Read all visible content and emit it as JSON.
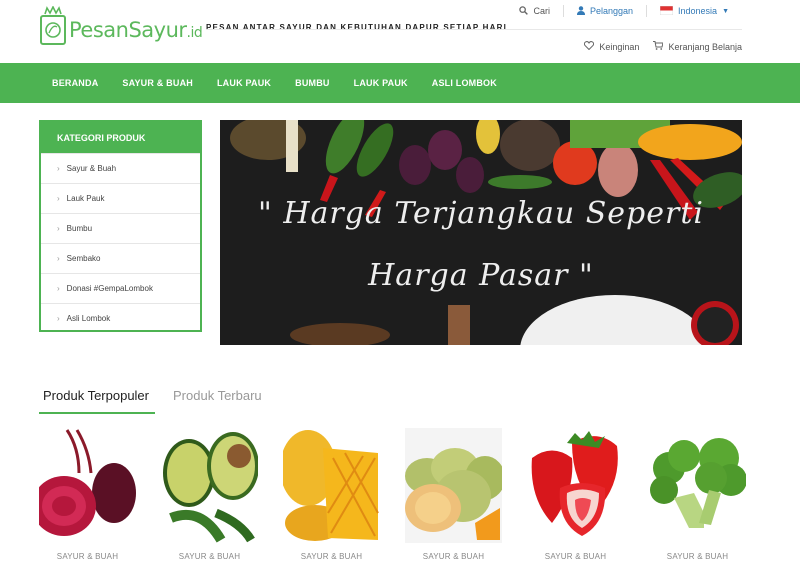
{
  "brand": {
    "logo_main": "PesanSayur",
    "logo_suffix": ".id",
    "tagline": "PESAN ANTAR SAYUR DAN KEBUTUHAN DAPUR SETIAP HARI",
    "accent": "#4db352"
  },
  "topbar": {
    "search_label": "Cari",
    "account_label": "Pelanggan",
    "language_label": "Indonesia"
  },
  "toplinks": {
    "wishlist_label": "Keinginan",
    "cart_label": "Keranjang Belanja"
  },
  "nav": {
    "items": [
      "BERANDA",
      "SAYUR & BUAH",
      "LAUK PAUK",
      "BUMBU",
      "LAUK PAUK",
      "ASLI LOMBOK"
    ]
  },
  "sidebar": {
    "title": "KATEGORI PRODUK",
    "items": [
      "Sayur & Buah",
      "Lauk Pauk",
      "Bumbu",
      "Sembako",
      "Donasi #GempaLombok",
      "Asli Lombok"
    ]
  },
  "banner": {
    "line1": "\" Harga Terjangkau Seperti",
    "line2": "Harga Pasar \""
  },
  "tabs": {
    "active_label": "Produk Terpopuler",
    "inactive_label": "Produk Terbaru"
  },
  "products": [
    {
      "category": "SAYUR & BUAH",
      "image": "beetroot"
    },
    {
      "category": "SAYUR & BUAH",
      "image": "avocado"
    },
    {
      "category": "SAYUR & BUAH",
      "image": "mango"
    },
    {
      "category": "SAYUR & BUAH",
      "image": "melon"
    },
    {
      "category": "SAYUR & BUAH",
      "image": "strawberry"
    },
    {
      "category": "SAYUR & BUAH",
      "image": "broccoli"
    }
  ]
}
